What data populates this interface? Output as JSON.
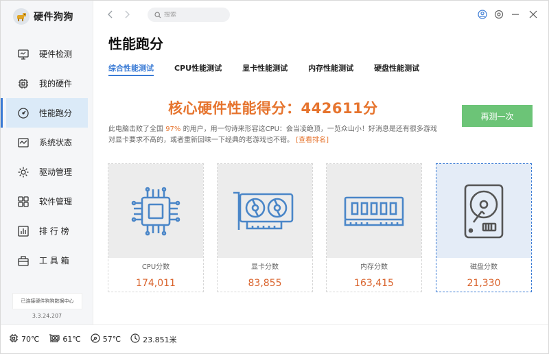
{
  "app": {
    "name": "硬件狗狗"
  },
  "sidebar": {
    "items": [
      {
        "label": "硬件检测",
        "icon": "monitor-icon"
      },
      {
        "label": "我的硬件",
        "icon": "chip-icon"
      },
      {
        "label": "性能跑分",
        "icon": "speedometer-icon"
      },
      {
        "label": "系统状态",
        "icon": "pulse-icon"
      },
      {
        "label": "驱动管理",
        "icon": "gear-icon"
      },
      {
        "label": "软件管理",
        "icon": "apps-icon"
      },
      {
        "label": "排 行 榜",
        "icon": "ranking-icon"
      },
      {
        "label": "工 具 箱",
        "icon": "toolbox-icon"
      }
    ],
    "active_index": 2,
    "connect_text": "已连接硬件狗狗数据中心",
    "version": "3.3.24.207"
  },
  "search": {
    "placeholder": "搜索"
  },
  "page": {
    "title": "性能跑分"
  },
  "tabs": [
    {
      "label": "综合性能测试",
      "active": true
    },
    {
      "label": "CPU性能测试",
      "active": false
    },
    {
      "label": "显卡性能测试",
      "active": false
    },
    {
      "label": "内存性能测试",
      "active": false
    },
    {
      "label": "硬盘性能测试",
      "active": false
    }
  ],
  "score": {
    "headline": "核心硬件性能得分：442611分",
    "retest_label": "再测一次",
    "desc_before": "此电脑击败了全国 ",
    "percent": "97%",
    "desc_after": " 的用户，用一句诗来形容这CPU：会当凌绝顶，一览众山小！好消息是还有很多游戏对显卡要求不高的，或者重新回味一下经典的老游戏也不错。",
    "link": "[查看排名]"
  },
  "cards": [
    {
      "label": "CPU分数",
      "value": "174,011"
    },
    {
      "label": "显卡分数",
      "value": "83,855"
    },
    {
      "label": "内存分数",
      "value": "163,415"
    },
    {
      "label": "磁盘分数",
      "value": "21,330"
    }
  ],
  "status": {
    "cpu_temp": "70℃",
    "gpu_temp": "61℃",
    "disk_temp": "57℃",
    "distance": "23.851米"
  },
  "colors": {
    "accent": "#3a7bd5",
    "score": "#e6742e",
    "retest": "#6cc477",
    "icon_blue": "#4a86c8"
  }
}
